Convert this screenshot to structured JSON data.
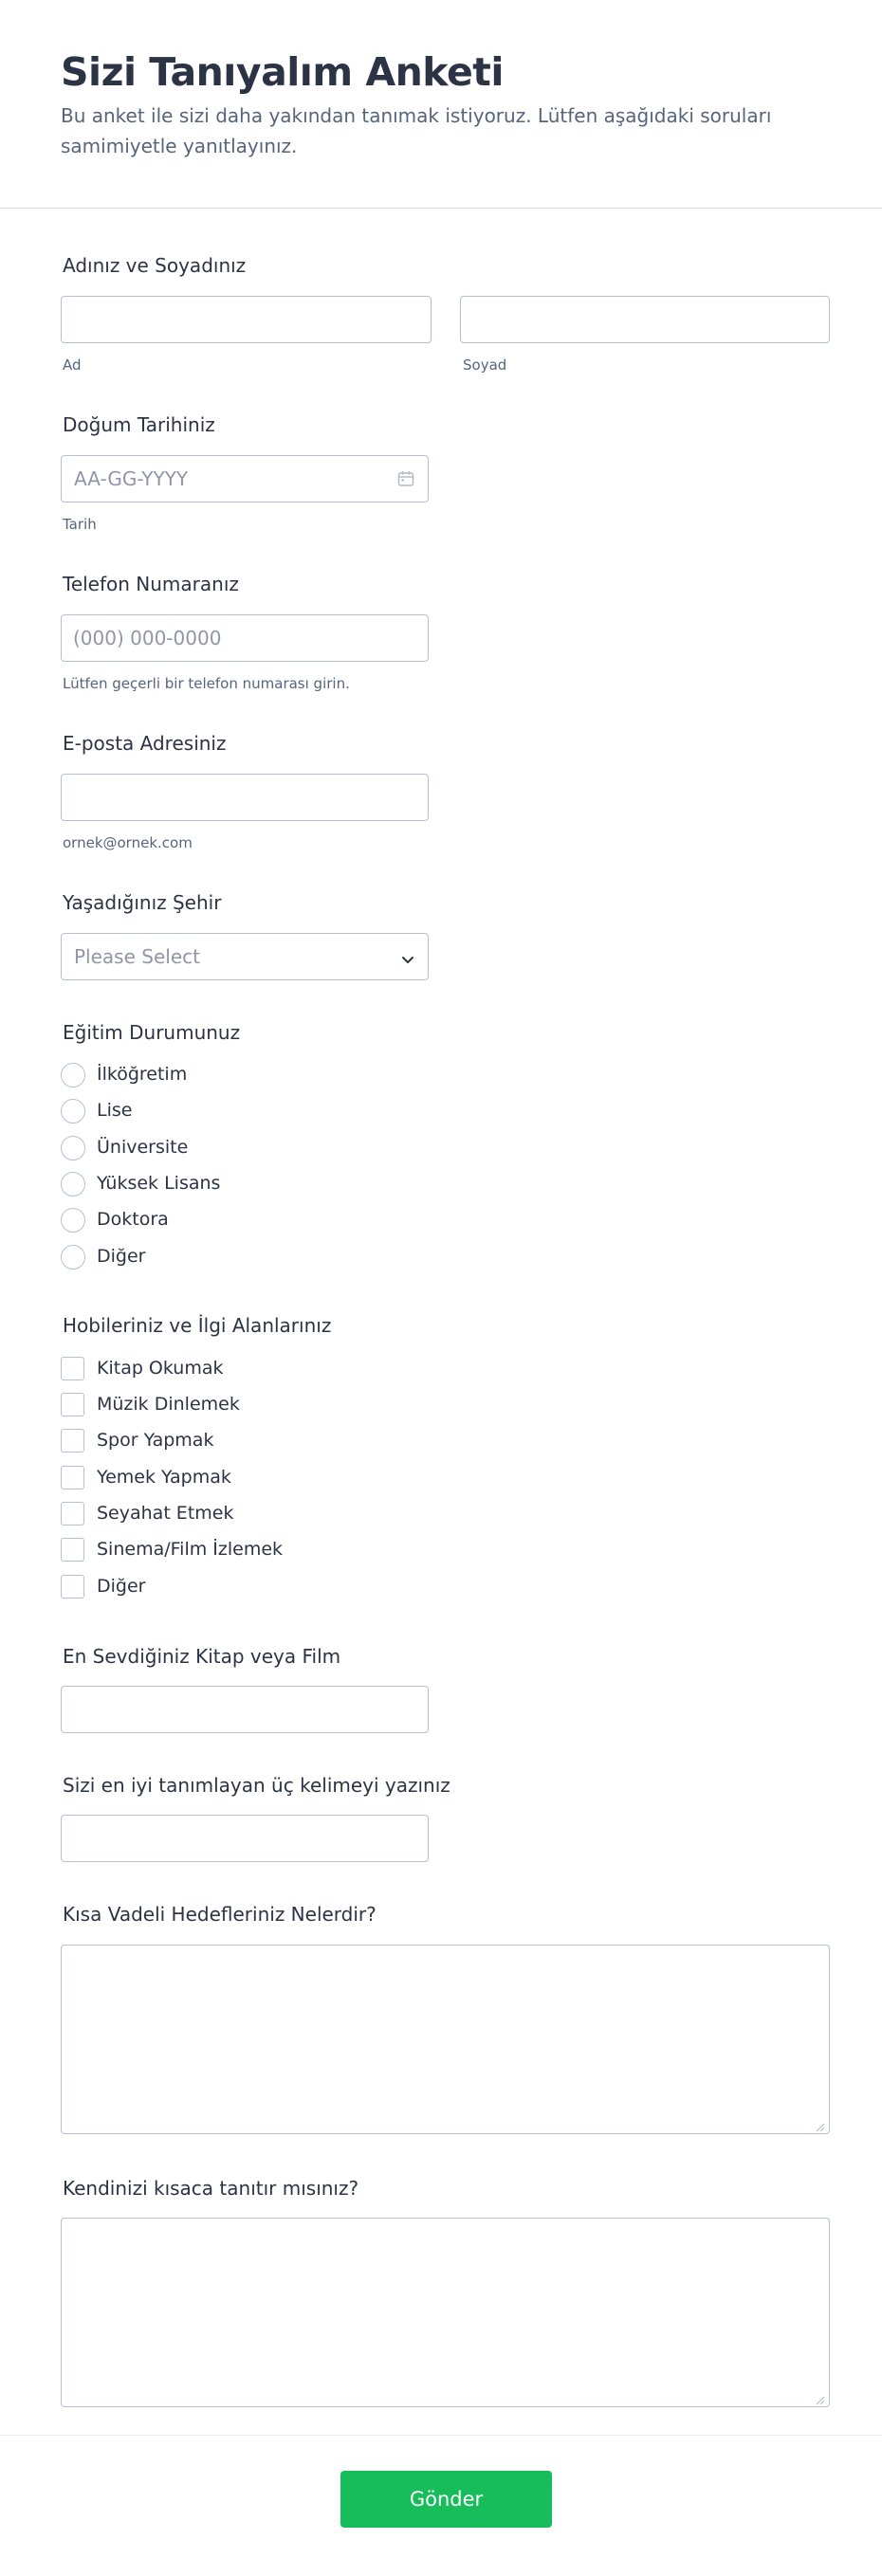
{
  "header": {
    "title": "Sizi Tanıyalım Anketi",
    "subtitle": "Bu anket ile sizi daha yakından tanımak istiyoruz. Lütfen aşağıdaki soruları samimiyetle yanıtlayınız."
  },
  "name": {
    "label": "Adınız ve Soyadınız",
    "first_sublabel": "Ad",
    "last_sublabel": "Soyad",
    "first_value": "",
    "last_value": ""
  },
  "birthdate": {
    "label": "Doğum Tarihiniz",
    "placeholder": "AA-GG-YYYY",
    "sublabel": "Tarih",
    "icon": "calendar-icon"
  },
  "phone": {
    "label": "Telefon Numaranız",
    "placeholder": "(000) 000-0000",
    "sublabel": "Lütfen geçerli bir telefon numarası girin."
  },
  "email": {
    "label": "E-posta Adresiniz",
    "sublabel": "ornek@ornek.com",
    "value": ""
  },
  "city": {
    "label": "Yaşadığınız Şehir",
    "selected": "Please Select",
    "icon": "chevron-down-icon"
  },
  "education": {
    "label": "Eğitim Durumunuz",
    "options": [
      "İlköğretim",
      "Lise",
      "Üniversite",
      "Yüksek Lisans",
      "Doktora",
      "Diğer"
    ]
  },
  "hobbies": {
    "label": "Hobileriniz ve İlgi Alanlarınız",
    "options": [
      "Kitap Okumak",
      "Müzik Dinlemek",
      "Spor Yapmak",
      "Yemek Yapmak",
      "Seyahat Etmek",
      "Sinema/Film İzlemek",
      "Diğer"
    ]
  },
  "favorite": {
    "label": "En Sevdiğiniz Kitap veya Film",
    "value": ""
  },
  "three_words": {
    "label": "Sizi en iyi tanımlayan üç kelimeyi yazınız",
    "value": ""
  },
  "goals": {
    "label": "Kısa Vadeli Hedefleriniz Nelerdir?",
    "value": ""
  },
  "about": {
    "label": "Kendinizi kısaca tanıtır mısınız?",
    "value": ""
  },
  "submit": {
    "label": "Gönder"
  },
  "colors": {
    "text": "#2c3345",
    "muted": "#57647e",
    "border": "#b8bdd6",
    "submit": "#18bd5b"
  }
}
